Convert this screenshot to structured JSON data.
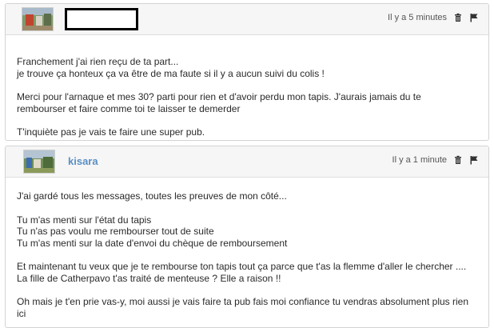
{
  "posts": [
    {
      "username": "",
      "time": "Il y a 5 minutes",
      "icons": {
        "delete": "trash-icon",
        "report": "flag-icon"
      },
      "paragraphs": [
        [
          "Franchement j'ai rien reçu de ta part...",
          "je trouve ça honteux ça va être de ma faute si il y a aucun suivi du colis !"
        ],
        [
          "Merci pour l'arnaque et mes 30? parti pour rien et d'avoir perdu mon tapis. J'aurais jamais du te",
          "rembourser et faire comme toi te laisser te demerder"
        ],
        [
          "T'inquiète pas je vais te faire une super pub."
        ]
      ]
    },
    {
      "username": "kisara",
      "time": "Il y a 1 minute",
      "icons": {
        "delete": "trash-icon",
        "report": "flag-icon"
      },
      "paragraphs": [
        [
          "J'ai gardé tous les messages, toutes les preuves de mon côté..."
        ],
        [
          "Tu m'as menti sur l'état du tapis",
          "Tu n'as pas voulu me rembourser tout de suite",
          "Tu m'as menti sur la date d'envoi du chèque de remboursement"
        ],
        [
          "Et maintenant tu veux que je te rembourse ton tapis tout ça parce que t'as la flemme d'aller le chercher ....",
          "La fille de Catherpavo t'as traité de menteuse ? Elle a raison !!"
        ],
        [
          "Oh mais je t'en prie vas-y, moi aussi je vais faire ta pub fais moi confiance tu vendras absolument plus rien",
          "ici"
        ]
      ]
    }
  ]
}
